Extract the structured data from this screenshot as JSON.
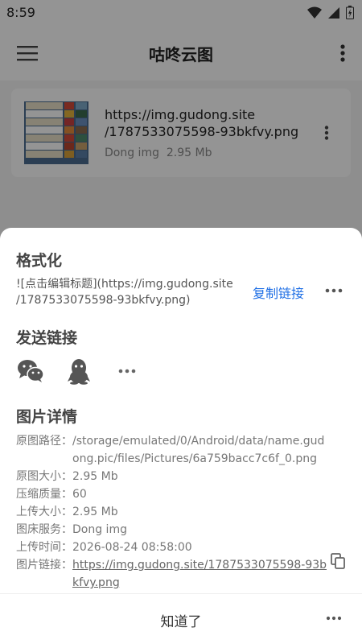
{
  "status_bar": {
    "time": "8:59"
  },
  "app_bar": {
    "title": "咕咚云图",
    "menu_icon": "hamburger-menu-icon",
    "more_icon": "vertical-dots-icon"
  },
  "image_card": {
    "url": "https://img.gudong.site/1787533075598-93bkfvy.png",
    "url_line1": "https://img.gudong.site",
    "url_line2": "/1787533075598-93bkfvy.png",
    "host": "Dong img",
    "size": "2.95 Mb"
  },
  "sheet": {
    "format_title": "格式化",
    "format_text_line1": "![点击编辑标题](https://img.gudong.site",
    "format_text_line2": "/1787533075598-93bkfvy.png)",
    "copy_link_label": "复制链接",
    "send_title": "发送链接",
    "share_targets": [
      "wechat-icon",
      "qq-icon",
      "more-horizontal-icon"
    ],
    "details_title": "图片详情",
    "details": [
      {
        "label": "原图路径：",
        "value": "/storage/emulated/0/Android/data/name.gudong.pic/files/Pictures/6a759bacc7c6f_0.png"
      },
      {
        "label": "原图大小：",
        "value": "2.95 Mb"
      },
      {
        "label": "压缩质量：",
        "value": "60"
      },
      {
        "label": "上传大小：",
        "value": "2.95 Mb"
      },
      {
        "label": "图床服务：",
        "value": "Dong img"
      },
      {
        "label": "上传时间：",
        "value": "2026-08-24 08:58:00"
      },
      {
        "label": "图片链接：",
        "value": "https://img.gudong.site/1787533075598-93bkfvy.png"
      }
    ],
    "ok_label": "知道了"
  },
  "colors": {
    "accent": "#1f6fe5",
    "overlay": "#000000"
  }
}
